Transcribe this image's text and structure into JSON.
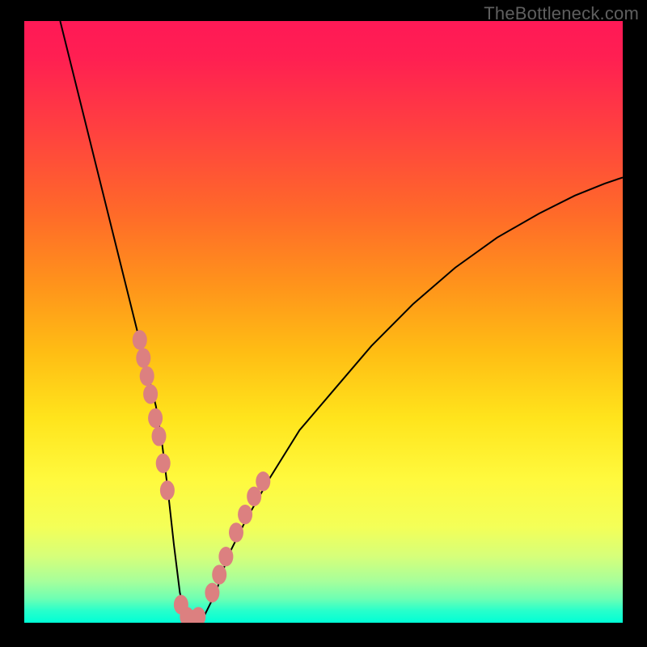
{
  "watermark": "TheBottleneck.com",
  "colors": {
    "background": "#000000",
    "gradient_top": "#ff1956",
    "gradient_bottom": "#00ffd6",
    "curve": "#000000",
    "bead": "#dc8080"
  },
  "chart_data": {
    "type": "line",
    "title": "",
    "xlabel": "",
    "ylabel": "",
    "annotations": [],
    "legend": [],
    "xlim": [
      0,
      100
    ],
    "ylim": [
      0,
      100
    ],
    "series": [
      {
        "name": "bottleneck-curve",
        "x": [
          6,
          8,
          10,
          12,
          14,
          16,
          18,
          20,
          21,
          22,
          23,
          24,
          25,
          26,
          27,
          28,
          29,
          30,
          32,
          34,
          37,
          41,
          46,
          52,
          58,
          65,
          72,
          79,
          86,
          92,
          97,
          100
        ],
        "y": [
          100,
          92,
          84,
          76,
          68,
          60,
          52,
          44,
          40,
          36,
          30,
          22,
          13,
          5,
          1,
          0,
          0,
          1,
          5,
          11,
          17,
          24,
          32,
          39,
          46,
          53,
          59,
          64,
          68,
          71,
          73,
          74
        ]
      }
    ],
    "markers": {
      "name": "salmon-beads",
      "points_xy": [
        [
          19.3,
          47
        ],
        [
          19.9,
          44
        ],
        [
          20.5,
          41
        ],
        [
          21.1,
          38
        ],
        [
          21.9,
          34
        ],
        [
          22.5,
          31
        ],
        [
          23.2,
          26.5
        ],
        [
          23.9,
          22
        ],
        [
          26.2,
          3
        ],
        [
          27.2,
          1
        ],
        [
          28.1,
          0.5
        ],
        [
          29.1,
          1
        ],
        [
          31.4,
          5
        ],
        [
          32.6,
          8
        ],
        [
          33.7,
          11
        ],
        [
          35.4,
          15
        ],
        [
          36.9,
          18
        ],
        [
          38.4,
          21
        ],
        [
          39.9,
          23.5
        ]
      ],
      "radius_px": 9
    }
  }
}
